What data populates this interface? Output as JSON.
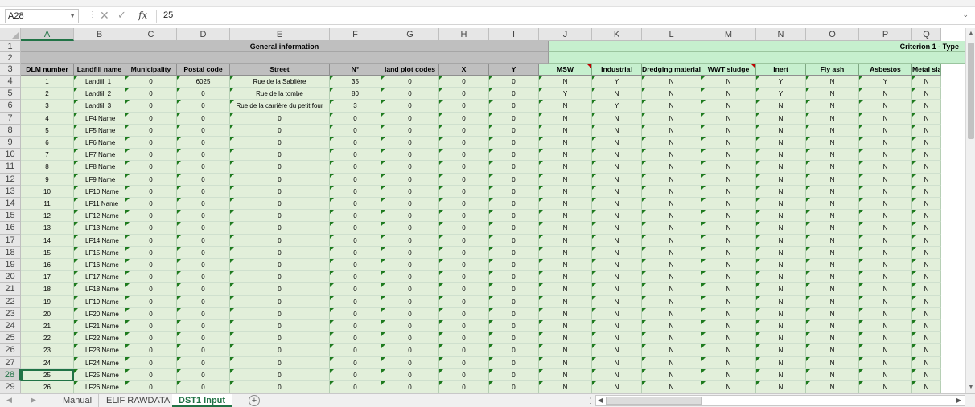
{
  "formula_bar": {
    "name_box": "A28",
    "cancel_glyph": "✕",
    "enter_glyph": "✓",
    "fx_glyph": "fx",
    "value": "25"
  },
  "columns": [
    "A",
    "B",
    "C",
    "D",
    "E",
    "F",
    "G",
    "H",
    "I",
    "J",
    "K",
    "L",
    "M",
    "N",
    "O",
    "P",
    "Q"
  ],
  "selected_column": "A",
  "row_numbers": [
    "1",
    "2",
    "3",
    "4",
    "5",
    "6",
    "7",
    "8",
    "9",
    "10",
    "11",
    "12",
    "13",
    "14",
    "15",
    "16",
    "17",
    "18",
    "19",
    "20",
    "21",
    "22",
    "23",
    "24",
    "25",
    "26",
    "27",
    "28",
    "29"
  ],
  "selected_row": "28",
  "bands": {
    "general": "General information",
    "criterion": "Criterion 1 - Type"
  },
  "headers": [
    "DLM number",
    "Landfill name",
    "Municipality",
    "Postal code",
    "Street",
    "N°",
    "land plot codes",
    "X",
    "Y",
    "MSW",
    "Industrial",
    "Dredging materials",
    "WWT sludge",
    "Inert",
    "Fly ash",
    "Asbestos",
    "Metal sla"
  ],
  "comment_marked_headers": [
    "MSW",
    "WWT sludge"
  ],
  "rows": [
    [
      "1",
      "Landfill 1",
      "0",
      "6025",
      "Rue de la Sablière",
      "35",
      "0",
      "0",
      "0",
      "N",
      "Y",
      "N",
      "N",
      "Y",
      "N",
      "Y",
      "N"
    ],
    [
      "2",
      "Landfill 2",
      "0",
      "0",
      "Rue de la tombe",
      "80",
      "0",
      "0",
      "0",
      "Y",
      "N",
      "N",
      "N",
      "Y",
      "N",
      "N",
      "N"
    ],
    [
      "3",
      "Landfill 3",
      "0",
      "0",
      "Rue de la carrière du petit four",
      "3",
      "0",
      "0",
      "0",
      "N",
      "Y",
      "N",
      "N",
      "N",
      "N",
      "N",
      "N"
    ],
    [
      "4",
      "LF4 Name",
      "0",
      "0",
      "0",
      "0",
      "0",
      "0",
      "0",
      "N",
      "N",
      "N",
      "N",
      "N",
      "N",
      "N",
      "N"
    ],
    [
      "5",
      "LF5 Name",
      "0",
      "0",
      "0",
      "0",
      "0",
      "0",
      "0",
      "N",
      "N",
      "N",
      "N",
      "N",
      "N",
      "N",
      "N"
    ],
    [
      "6",
      "LF6 Name",
      "0",
      "0",
      "0",
      "0",
      "0",
      "0",
      "0",
      "N",
      "N",
      "N",
      "N",
      "N",
      "N",
      "N",
      "N"
    ],
    [
      "7",
      "LF7 Name",
      "0",
      "0",
      "0",
      "0",
      "0",
      "0",
      "0",
      "N",
      "N",
      "N",
      "N",
      "N",
      "N",
      "N",
      "N"
    ],
    [
      "8",
      "LF8 Name",
      "0",
      "0",
      "0",
      "0",
      "0",
      "0",
      "0",
      "N",
      "N",
      "N",
      "N",
      "N",
      "N",
      "N",
      "N"
    ],
    [
      "9",
      "LF9 Name",
      "0",
      "0",
      "0",
      "0",
      "0",
      "0",
      "0",
      "N",
      "N",
      "N",
      "N",
      "N",
      "N",
      "N",
      "N"
    ],
    [
      "10",
      "LF10 Name",
      "0",
      "0",
      "0",
      "0",
      "0",
      "0",
      "0",
      "N",
      "N",
      "N",
      "N",
      "N",
      "N",
      "N",
      "N"
    ],
    [
      "11",
      "LF11 Name",
      "0",
      "0",
      "0",
      "0",
      "0",
      "0",
      "0",
      "N",
      "N",
      "N",
      "N",
      "N",
      "N",
      "N",
      "N"
    ],
    [
      "12",
      "LF12 Name",
      "0",
      "0",
      "0",
      "0",
      "0",
      "0",
      "0",
      "N",
      "N",
      "N",
      "N",
      "N",
      "N",
      "N",
      "N"
    ],
    [
      "13",
      "LF13 Name",
      "0",
      "0",
      "0",
      "0",
      "0",
      "0",
      "0",
      "N",
      "N",
      "N",
      "N",
      "N",
      "N",
      "N",
      "N"
    ],
    [
      "14",
      "LF14 Name",
      "0",
      "0",
      "0",
      "0",
      "0",
      "0",
      "0",
      "N",
      "N",
      "N",
      "N",
      "N",
      "N",
      "N",
      "N"
    ],
    [
      "15",
      "LF15 Name",
      "0",
      "0",
      "0",
      "0",
      "0",
      "0",
      "0",
      "N",
      "N",
      "N",
      "N",
      "N",
      "N",
      "N",
      "N"
    ],
    [
      "16",
      "LF16 Name",
      "0",
      "0",
      "0",
      "0",
      "0",
      "0",
      "0",
      "N",
      "N",
      "N",
      "N",
      "N",
      "N",
      "N",
      "N"
    ],
    [
      "17",
      "LF17 Name",
      "0",
      "0",
      "0",
      "0",
      "0",
      "0",
      "0",
      "N",
      "N",
      "N",
      "N",
      "N",
      "N",
      "N",
      "N"
    ],
    [
      "18",
      "LF18 Name",
      "0",
      "0",
      "0",
      "0",
      "0",
      "0",
      "0",
      "N",
      "N",
      "N",
      "N",
      "N",
      "N",
      "N",
      "N"
    ],
    [
      "19",
      "LF19 Name",
      "0",
      "0",
      "0",
      "0",
      "0",
      "0",
      "0",
      "N",
      "N",
      "N",
      "N",
      "N",
      "N",
      "N",
      "N"
    ],
    [
      "20",
      "LF20 Name",
      "0",
      "0",
      "0",
      "0",
      "0",
      "0",
      "0",
      "N",
      "N",
      "N",
      "N",
      "N",
      "N",
      "N",
      "N"
    ],
    [
      "21",
      "LF21 Name",
      "0",
      "0",
      "0",
      "0",
      "0",
      "0",
      "0",
      "N",
      "N",
      "N",
      "N",
      "N",
      "N",
      "N",
      "N"
    ],
    [
      "22",
      "LF22 Name",
      "0",
      "0",
      "0",
      "0",
      "0",
      "0",
      "0",
      "N",
      "N",
      "N",
      "N",
      "N",
      "N",
      "N",
      "N"
    ],
    [
      "23",
      "LF23 Name",
      "0",
      "0",
      "0",
      "0",
      "0",
      "0",
      "0",
      "N",
      "N",
      "N",
      "N",
      "N",
      "N",
      "N",
      "N"
    ],
    [
      "24",
      "LF24 Name",
      "0",
      "0",
      "0",
      "0",
      "0",
      "0",
      "0",
      "N",
      "N",
      "N",
      "N",
      "N",
      "N",
      "N",
      "N"
    ],
    [
      "25",
      "LF25 Name",
      "0",
      "0",
      "0",
      "0",
      "0",
      "0",
      "0",
      "N",
      "N",
      "N",
      "N",
      "N",
      "N",
      "N",
      "N"
    ],
    [
      "26",
      "LF26 Name",
      "0",
      "0",
      "0",
      "0",
      "0",
      "0",
      "0",
      "N",
      "N",
      "N",
      "N",
      "N",
      "N",
      "N",
      "N"
    ]
  ],
  "active_cell": "A28",
  "sheet_tabs": [
    {
      "label": "Manual",
      "active": false
    },
    {
      "label": "ELIF RAWDATA",
      "active": false
    },
    {
      "label": "DST1 Input",
      "active": true
    }
  ],
  "add_sheet_glyph": "+",
  "colors": {
    "accent": "#217346",
    "band_grey": "#bfbfbf",
    "band_green": "#c6efce",
    "cell_green": "#e2efda",
    "comment_red": "#c00000",
    "error_triangle": "#1e7b1e"
  }
}
